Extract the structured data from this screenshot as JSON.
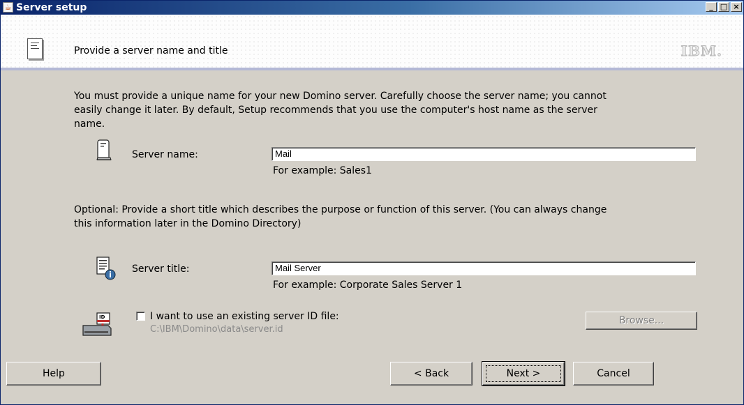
{
  "window": {
    "title": "Server setup",
    "minimize_glyph": "_",
    "maximize_glyph": "□",
    "close_glyph": "×"
  },
  "header": {
    "heading": "Provide a server name and title",
    "brand": "IBM."
  },
  "intro": {
    "line1": "You must provide a unique name for your new Domino server. Carefully choose the server name; you cannot",
    "line2": "easily change it later. By default, Setup recommends that you use the computer's host name as the server",
    "line3": "name."
  },
  "server_name": {
    "label": "Server name:",
    "value": "Mail",
    "hint": "For example: Sales1"
  },
  "optional": {
    "line1": "Optional: Provide a short title which describes the purpose or function of this server. (You can always change",
    "line2": "this information later in the Domino Directory)"
  },
  "server_title": {
    "label": "Server title:",
    "value": "Mail Server",
    "hint": "For example: Corporate Sales Server 1"
  },
  "id_file": {
    "checkbox_label": "I want to use an existing server ID file:",
    "checked": false,
    "path": "C:\\IBM\\Domino\\data\\server.id",
    "browse_label": "Browse..."
  },
  "buttons": {
    "help": "Help",
    "back": "< Back",
    "next": "Next >",
    "cancel": "Cancel"
  },
  "icons": {
    "app": "java-cup-icon",
    "header": "document-icon",
    "server_name": "server-tower-icon",
    "server_title": "document-info-icon",
    "id_file": "id-card-disk-icon"
  }
}
